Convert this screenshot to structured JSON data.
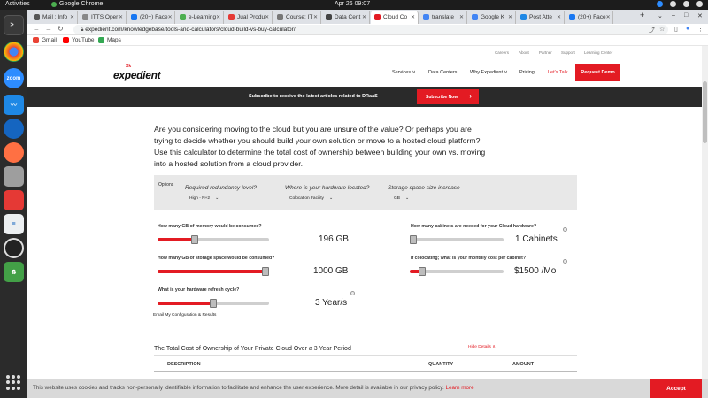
{
  "topbar": {
    "activities": "Activities",
    "app_name": "Google Chrome",
    "clock": "Apr 26  09:07"
  },
  "tabs": [
    {
      "label": "Mail : Info",
      "color": "#555555"
    },
    {
      "label": "ITTS Oper",
      "color": "#888888"
    },
    {
      "label": "(20+) Face",
      "color": "#1877f2"
    },
    {
      "label": "e-Learning",
      "color": "#4caf50"
    },
    {
      "label": "Jual Produ",
      "color": "#e53935"
    },
    {
      "label": "Course: IT",
      "color": "#777777"
    },
    {
      "label": "Data Cent",
      "color": "#444444"
    },
    {
      "label": "Cloud Co",
      "color": "#e31b23",
      "active": true
    },
    {
      "label": "translate",
      "color": "#4285f4"
    },
    {
      "label": "Google K",
      "color": "#4285f4"
    },
    {
      "label": "Post Atte",
      "color": "#1e88e5"
    },
    {
      "label": "(20+) Face",
      "color": "#1877f2"
    }
  ],
  "address_bar": {
    "url": "expedient.com/knowledgebase/tools-and-calculators/cloud-build-vs-buy-calculator/"
  },
  "bookmarks": [
    {
      "label": "Gmail",
      "color": "#ea4335"
    },
    {
      "label": "YouTube",
      "color": "#ff0000"
    },
    {
      "label": "Maps",
      "color": "#34a853"
    }
  ],
  "site": {
    "utility_links": [
      "Careers",
      "About",
      "Partner",
      "Support",
      "Learning Center"
    ],
    "logo_text": "expedient",
    "logo_mark": "Xk",
    "nav": [
      "Services ∨",
      "Data Centers",
      "Why Expedient ∨",
      "Pricing",
      "Let's Talk"
    ],
    "request_demo": "Request Demo",
    "subscribe_text": "Subscribe to receive the latest articles related to DRaaS",
    "subscribe_button": "Subscribe Now"
  },
  "intro": "Are you considering moving to the cloud but you are unsure of the value? Or perhaps you are trying to decide whether you should build your own solution or move to a hosted cloud platform? Use this calculator to determine the total cost of ownership between building your own vs. moving into a hosted solution from a cloud provider.",
  "options": {
    "label": "Options",
    "redundancy_title": "Required redundancy level?",
    "redundancy_value": "High - N+2",
    "location_title": "Where is your hardware located?",
    "location_value": "Colocation Facility",
    "storage_title": "Storage space size increase",
    "storage_value": "GB"
  },
  "calculator": {
    "memory_label": "How many GB of memory would be consumed?",
    "memory_value": "196 GB",
    "memory_level": 0.32,
    "storage_label": "How many GB of storage space would be consumed?",
    "storage_value": "1000 GB",
    "storage_level": 1.0,
    "refresh_label": "What is your hardware refresh cycle?",
    "refresh_value": "3 Year/s",
    "refresh_level": 0.5,
    "cabinets_label": "How many cabinets are needed for your Cloud hardware?",
    "cabinets_value": "1 Cabinets",
    "cabinets_level": 0.0,
    "cost_label": "If colocating; what is your monthly cost per cabinet?",
    "cost_value": "$1500 /Mo",
    "cost_level": 0.1,
    "email_link": "Email My Configuration & Results"
  },
  "tco": {
    "title": "The Total Cost of Ownership of Your Private Cloud Over a 3 Year Period",
    "hide_details": "Hide Details ∧",
    "columns": [
      "DESCRIPTION",
      "QUANTITY",
      "AMOUNT"
    ]
  },
  "cookie": {
    "text": "This website uses cookies and tracks non-personally identifiable information to facilitate and enhance the user experience. More detail is available in our privacy policy.",
    "more": "Learn more",
    "accept": "Accept"
  }
}
